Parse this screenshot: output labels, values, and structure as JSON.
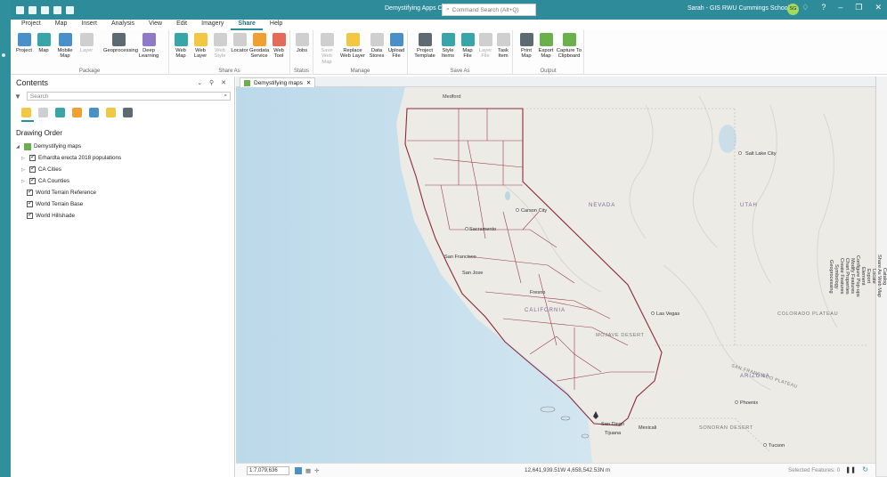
{
  "app_title": "Demystifying Apps Cal IPC",
  "command_search_placeholder": "Command Search (Alt+Q)",
  "user": "Sarah - GIS RWU Cummings School",
  "user_initials": "SG",
  "ribbon_tabs": [
    "Project",
    "Map",
    "Insert",
    "Analysis",
    "View",
    "Edit",
    "Imagery",
    "Share",
    "Help"
  ],
  "active_tab": "Share",
  "groups": {
    "package": {
      "label": "Package",
      "buttons": [
        "Project",
        "Map",
        "Mobile Map",
        "Layer",
        "Geoprocessing",
        "Deep Learning"
      ]
    },
    "share_as": {
      "label": "Share As",
      "buttons": [
        "Web Map",
        "Web Layer",
        "Web Style",
        "Locator",
        "Geodata Service",
        "Web Tool"
      ]
    },
    "status": {
      "label": "Status",
      "buttons": [
        "Jobs"
      ]
    },
    "manage": {
      "label": "Manage",
      "buttons": [
        "Save Web Map",
        "Replace Web Layer",
        "Data Stores",
        "Upload File"
      ]
    },
    "save_as": {
      "label": "Save As",
      "buttons": [
        "Project Template",
        "Style Items",
        "Map File",
        "Layer File",
        "Task Item"
      ]
    },
    "output": {
      "label": "Output",
      "buttons": [
        "Print Map",
        "Export Map",
        "Capture To Clipboard"
      ]
    }
  },
  "contents": {
    "title": "Contents",
    "search_placeholder": "Search",
    "drawing_order": "Drawing Order",
    "map_name": "Demystifying maps",
    "layers": [
      "Erhardta erecta 2018 populations",
      "CA Cities",
      "CA Counties",
      "World Terrain Reference",
      "World Terrain Base",
      "World Hillshade"
    ]
  },
  "map_tab": "Demystifying maps",
  "map_labels": {
    "medford": "Medford",
    "carson": "Carson City",
    "sacramento": "Sacramento",
    "sanfrancisco": "San Francisco",
    "sanjose": "San Jose",
    "fresno": "Fresno",
    "california": "CALIFORNIA",
    "nevada": "NEVADA",
    "utah": "UTAH",
    "saltlake": "Salt Lake City",
    "lasvegas": "Las Vegas",
    "mojave": "MOJAVE DESERT",
    "colorado": "COLORADO PLATEAU",
    "arizona": "ARIZONA",
    "phoenix": "Phoenix",
    "tucson": "Tucson",
    "sandiego": "San Diego",
    "tijuana": "Tijuana",
    "mexicali": "Mexicali",
    "sonoran": "SONORAN DESERT",
    "sanfranciscoplateau": "SAN FRANCISCO PLATEAU"
  },
  "right_panels": [
    "Catalog",
    "Share As Web Map",
    "Locate",
    "Export",
    "Element",
    "Configure Pop-ups",
    "Modify Features",
    "Chart Properties",
    "Create Features",
    "Symbology",
    "Geoprocessing"
  ],
  "status": {
    "scale": "1:7,079,636",
    "coords": "12,641,939.51W 4,658,542.53N m",
    "selected": "Selected Features: 0"
  }
}
